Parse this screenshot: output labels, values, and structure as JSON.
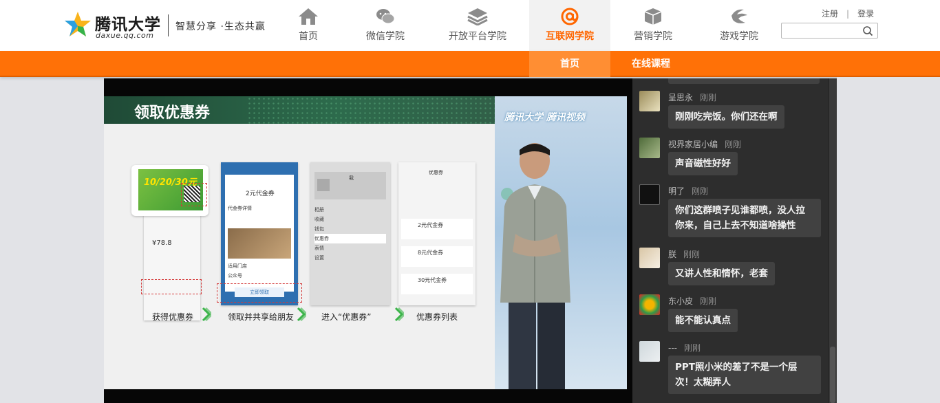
{
  "logo": {
    "brand": "腾讯大学",
    "domain": "daxue.qq.com",
    "slogan": "智慧分享 ·生态共赢"
  },
  "nav": {
    "items": [
      {
        "label": "首页",
        "icon": "home-icon"
      },
      {
        "label": "微信学院",
        "icon": "wechat-icon"
      },
      {
        "label": "开放平台学院",
        "icon": "layers-icon"
      },
      {
        "label": "互联网学院",
        "icon": "at-sign-icon"
      },
      {
        "label": "营销学院",
        "icon": "box-icon"
      },
      {
        "label": "游戏学院",
        "icon": "game-icon"
      }
    ],
    "active_index": 3
  },
  "auth": {
    "register": "注册",
    "separator": "|",
    "login": "登录"
  },
  "search": {
    "placeholder": ""
  },
  "subnav": {
    "tabs": [
      "首页",
      "在线课程"
    ]
  },
  "slide": {
    "title": "领取优惠券",
    "watermark": "腾讯大学 腾讯视频",
    "steps": [
      {
        "label": "获得优惠券",
        "lines": [
          "10/20/30元",
          "¥78.8"
        ]
      },
      {
        "label": "领取并共享给朋友",
        "lines": [
          "2元代金券",
          "代金券详情",
          "适用门店",
          "公众号",
          "立即领取"
        ]
      },
      {
        "label": "进入“优惠券”",
        "lines": [
          "我",
          "相册",
          "收藏",
          "钱包",
          "优惠券",
          "表情",
          "设置"
        ]
      },
      {
        "label": "优惠券列表",
        "lines": [
          "优惠券",
          "2元代金券",
          "8元代金券",
          "30元代金券"
        ]
      }
    ]
  },
  "chat": {
    "messages": [
      {
        "user": "呈思永",
        "time": "刚刚",
        "text": "刚刚吃完饭。你们还在啊"
      },
      {
        "user": "视界家居小编",
        "time": "刚刚",
        "text": "声音磁性好好"
      },
      {
        "user": "明了",
        "time": "刚刚",
        "text": "你们这群喷子见谁都喷，没人拉你来，自己上去不知道啥操性"
      },
      {
        "user": "朕",
        "time": "刚刚",
        "text": "又讲人性和情怀，老套"
      },
      {
        "user": "东小皮",
        "time": "刚刚",
        "text": "能不能认真点"
      },
      {
        "user": "---",
        "time": "刚刚",
        "text": "PPT照小米的差了不是一个层次！太糊弄人"
      }
    ]
  },
  "colors": {
    "accent": "#ff7107",
    "chat_bg": "#2d2d2d",
    "bubble_bg": "#414141"
  }
}
